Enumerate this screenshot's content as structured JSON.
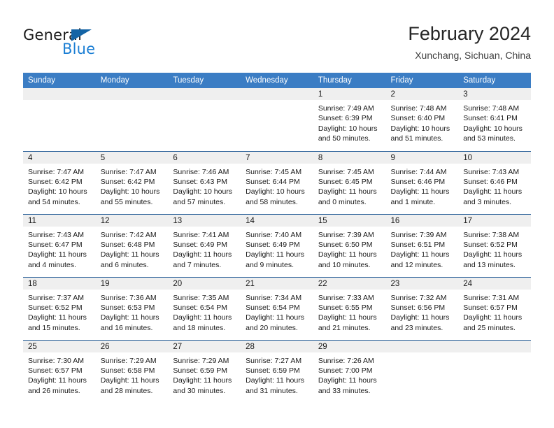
{
  "brand": {
    "name_part1": "General",
    "name_part2": "Blue",
    "accent_color": "#1c7fd4",
    "triangle_color": "#1464a5"
  },
  "header": {
    "title": "February 2024",
    "subtitle": "Xunchang, Sichuan, China"
  },
  "theme": {
    "header_bg": "#3b7dc4",
    "row_divider": "#2a6099",
    "daynum_bg": "#efefef"
  },
  "calendar": {
    "weekday_headers": [
      "Sunday",
      "Monday",
      "Tuesday",
      "Wednesday",
      "Thursday",
      "Friday",
      "Saturday"
    ],
    "weeks": [
      [
        {
          "day": "",
          "sunrise": "",
          "sunset": "",
          "daylight": "",
          "empty": true
        },
        {
          "day": "",
          "sunrise": "",
          "sunset": "",
          "daylight": "",
          "empty": true
        },
        {
          "day": "",
          "sunrise": "",
          "sunset": "",
          "daylight": "",
          "empty": true
        },
        {
          "day": "",
          "sunrise": "",
          "sunset": "",
          "daylight": "",
          "empty": true
        },
        {
          "day": "1",
          "sunrise": "Sunrise: 7:49 AM",
          "sunset": "Sunset: 6:39 PM",
          "daylight": "Daylight: 10 hours and 50 minutes."
        },
        {
          "day": "2",
          "sunrise": "Sunrise: 7:48 AM",
          "sunset": "Sunset: 6:40 PM",
          "daylight": "Daylight: 10 hours and 51 minutes."
        },
        {
          "day": "3",
          "sunrise": "Sunrise: 7:48 AM",
          "sunset": "Sunset: 6:41 PM",
          "daylight": "Daylight: 10 hours and 53 minutes."
        }
      ],
      [
        {
          "day": "4",
          "sunrise": "Sunrise: 7:47 AM",
          "sunset": "Sunset: 6:42 PM",
          "daylight": "Daylight: 10 hours and 54 minutes."
        },
        {
          "day": "5",
          "sunrise": "Sunrise: 7:47 AM",
          "sunset": "Sunset: 6:42 PM",
          "daylight": "Daylight: 10 hours and 55 minutes."
        },
        {
          "day": "6",
          "sunrise": "Sunrise: 7:46 AM",
          "sunset": "Sunset: 6:43 PM",
          "daylight": "Daylight: 10 hours and 57 minutes."
        },
        {
          "day": "7",
          "sunrise": "Sunrise: 7:45 AM",
          "sunset": "Sunset: 6:44 PM",
          "daylight": "Daylight: 10 hours and 58 minutes."
        },
        {
          "day": "8",
          "sunrise": "Sunrise: 7:45 AM",
          "sunset": "Sunset: 6:45 PM",
          "daylight": "Daylight: 11 hours and 0 minutes."
        },
        {
          "day": "9",
          "sunrise": "Sunrise: 7:44 AM",
          "sunset": "Sunset: 6:46 PM",
          "daylight": "Daylight: 11 hours and 1 minute."
        },
        {
          "day": "10",
          "sunrise": "Sunrise: 7:43 AM",
          "sunset": "Sunset: 6:46 PM",
          "daylight": "Daylight: 11 hours and 3 minutes."
        }
      ],
      [
        {
          "day": "11",
          "sunrise": "Sunrise: 7:43 AM",
          "sunset": "Sunset: 6:47 PM",
          "daylight": "Daylight: 11 hours and 4 minutes."
        },
        {
          "day": "12",
          "sunrise": "Sunrise: 7:42 AM",
          "sunset": "Sunset: 6:48 PM",
          "daylight": "Daylight: 11 hours and 6 minutes."
        },
        {
          "day": "13",
          "sunrise": "Sunrise: 7:41 AM",
          "sunset": "Sunset: 6:49 PM",
          "daylight": "Daylight: 11 hours and 7 minutes."
        },
        {
          "day": "14",
          "sunrise": "Sunrise: 7:40 AM",
          "sunset": "Sunset: 6:49 PM",
          "daylight": "Daylight: 11 hours and 9 minutes."
        },
        {
          "day": "15",
          "sunrise": "Sunrise: 7:39 AM",
          "sunset": "Sunset: 6:50 PM",
          "daylight": "Daylight: 11 hours and 10 minutes."
        },
        {
          "day": "16",
          "sunrise": "Sunrise: 7:39 AM",
          "sunset": "Sunset: 6:51 PM",
          "daylight": "Daylight: 11 hours and 12 minutes."
        },
        {
          "day": "17",
          "sunrise": "Sunrise: 7:38 AM",
          "sunset": "Sunset: 6:52 PM",
          "daylight": "Daylight: 11 hours and 13 minutes."
        }
      ],
      [
        {
          "day": "18",
          "sunrise": "Sunrise: 7:37 AM",
          "sunset": "Sunset: 6:52 PM",
          "daylight": "Daylight: 11 hours and 15 minutes."
        },
        {
          "day": "19",
          "sunrise": "Sunrise: 7:36 AM",
          "sunset": "Sunset: 6:53 PM",
          "daylight": "Daylight: 11 hours and 16 minutes."
        },
        {
          "day": "20",
          "sunrise": "Sunrise: 7:35 AM",
          "sunset": "Sunset: 6:54 PM",
          "daylight": "Daylight: 11 hours and 18 minutes."
        },
        {
          "day": "21",
          "sunrise": "Sunrise: 7:34 AM",
          "sunset": "Sunset: 6:54 PM",
          "daylight": "Daylight: 11 hours and 20 minutes."
        },
        {
          "day": "22",
          "sunrise": "Sunrise: 7:33 AM",
          "sunset": "Sunset: 6:55 PM",
          "daylight": "Daylight: 11 hours and 21 minutes."
        },
        {
          "day": "23",
          "sunrise": "Sunrise: 7:32 AM",
          "sunset": "Sunset: 6:56 PM",
          "daylight": "Daylight: 11 hours and 23 minutes."
        },
        {
          "day": "24",
          "sunrise": "Sunrise: 7:31 AM",
          "sunset": "Sunset: 6:57 PM",
          "daylight": "Daylight: 11 hours and 25 minutes."
        }
      ],
      [
        {
          "day": "25",
          "sunrise": "Sunrise: 7:30 AM",
          "sunset": "Sunset: 6:57 PM",
          "daylight": "Daylight: 11 hours and 26 minutes."
        },
        {
          "day": "26",
          "sunrise": "Sunrise: 7:29 AM",
          "sunset": "Sunset: 6:58 PM",
          "daylight": "Daylight: 11 hours and 28 minutes."
        },
        {
          "day": "27",
          "sunrise": "Sunrise: 7:29 AM",
          "sunset": "Sunset: 6:59 PM",
          "daylight": "Daylight: 11 hours and 30 minutes."
        },
        {
          "day": "28",
          "sunrise": "Sunrise: 7:27 AM",
          "sunset": "Sunset: 6:59 PM",
          "daylight": "Daylight: 11 hours and 31 minutes."
        },
        {
          "day": "29",
          "sunrise": "Sunrise: 7:26 AM",
          "sunset": "Sunset: 7:00 PM",
          "daylight": "Daylight: 11 hours and 33 minutes."
        },
        {
          "day": "",
          "sunrise": "",
          "sunset": "",
          "daylight": "",
          "empty": true
        },
        {
          "day": "",
          "sunrise": "",
          "sunset": "",
          "daylight": "",
          "empty": true
        }
      ]
    ]
  }
}
